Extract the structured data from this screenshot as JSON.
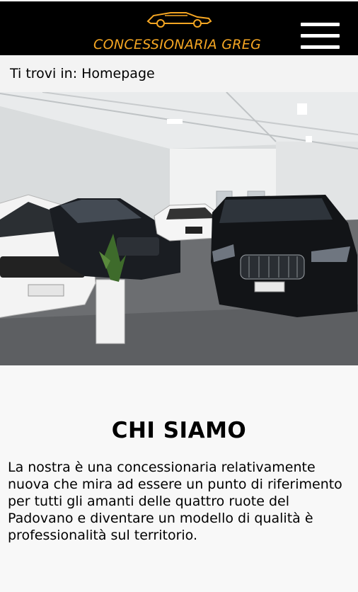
{
  "header": {
    "brand": "CONCESSIONARIA GREG",
    "logo_icon": "car-logo-icon",
    "menu_icon": "hamburger-menu-icon",
    "accent_color": "#f5a623"
  },
  "breadcrumb": {
    "text": "Ti trovi in: Homepage"
  },
  "hero": {
    "image": "showroom-photo"
  },
  "about": {
    "title": "CHI SIAMO",
    "text": "La nostra è una concessionaria relativamente nuova che mira ad essere un punto di riferimento per tutti gli amanti delle quattro ruote del Padovano e diventare un modello di qualità è professionalità sul territorio."
  }
}
